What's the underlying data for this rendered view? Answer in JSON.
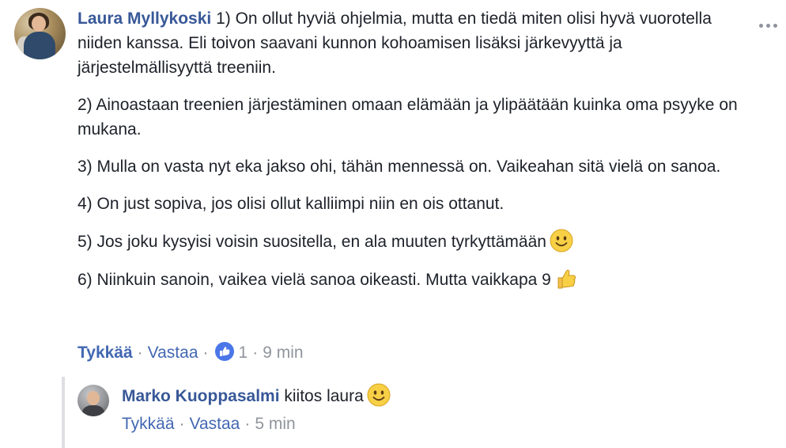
{
  "comment": {
    "author": "Laura Myllykoski",
    "paragraphs": [
      "1) On ollut hyviä ohjelmia, mutta en tiedä miten olisi hyvä vuorotella niiden kanssa. Eli toivon saavani kunnon kohoamisen lisäksi järkevyyttä ja järjestelmällisyyttä treeniin.",
      "2) Ainoastaan treenien järjestäminen omaan elämään ja ylipäätään kuinka oma psyyke on mukana.",
      "3) Mulla on vasta nyt eka jakso ohi, tähän mennessä on. Vaikeahan sitä vielä on sanoa.",
      "4) On just sopiva, jos olisi ollut kalliimpi niin en ois ottanut.",
      "5) Jos joku kysyisi voisin suositella, en ala muuten tyrkyttämään",
      "6) Niinkuin sanoin, vaikea vielä sanoa oikeasti. Mutta vaikkapa 9"
    ],
    "emoji_p5": "smiling-face-emoji",
    "emoji_p6": "thumbs-up-emoji",
    "actions": {
      "like": "Tykkää",
      "reply": "Vastaa",
      "like_count": "1",
      "time": "9 min",
      "separator": "·"
    }
  },
  "reply": {
    "author": "Marko Kuoppasalmi",
    "text": "kiitos laura",
    "emoji": "smiling-face-emoji",
    "actions": {
      "like": "Tykkää",
      "reply": "Vastaa",
      "time": "5 min",
      "separator": "·"
    }
  },
  "colors": {
    "author": "#385898",
    "link": "#4267b2",
    "meta": "#90949c",
    "text": "#1d2129",
    "thread_line": "#dddfe2"
  }
}
